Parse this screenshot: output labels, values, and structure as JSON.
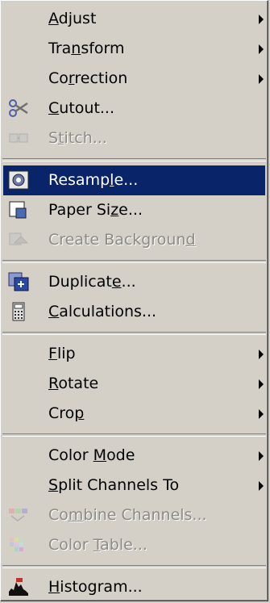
{
  "menu": {
    "groups": [
      [
        {
          "name": "adjust",
          "label": "Adjust",
          "submenu": true
        },
        {
          "name": "transform",
          "label": "Transform",
          "submenu": true
        },
        {
          "name": "correction",
          "label": "Correction",
          "submenu": true
        },
        {
          "name": "cutout",
          "label": "Cutout...",
          "icon": "scissors-icon"
        },
        {
          "name": "stitch",
          "label": "Stitch...",
          "icon": "stitch-icon",
          "disabled": true
        }
      ],
      [
        {
          "name": "resample",
          "label": "Resample...",
          "icon": "resample-icon",
          "selected": true
        },
        {
          "name": "paper-size",
          "label": "Paper Size...",
          "icon": "paper-size-icon"
        },
        {
          "name": "create-background",
          "label": "Create Background",
          "icon": "create-background-icon",
          "disabled": true
        }
      ],
      [
        {
          "name": "duplicate",
          "label": "Duplicate...",
          "icon": "duplicate-icon"
        },
        {
          "name": "calculations",
          "label": "Calculations...",
          "icon": "calculator-icon"
        }
      ],
      [
        {
          "name": "flip",
          "label": "Flip",
          "submenu": true
        },
        {
          "name": "rotate",
          "label": "Rotate",
          "submenu": true
        },
        {
          "name": "crop",
          "label": "Crop",
          "submenu": true
        }
      ],
      [
        {
          "name": "color-mode",
          "label": "Color Mode",
          "submenu": true
        },
        {
          "name": "split-channels-to",
          "label": "Split Channels To",
          "submenu": true
        },
        {
          "name": "combine-channels",
          "label": "Combine Channels...",
          "icon": "combine-channels-icon",
          "disabled": true
        },
        {
          "name": "color-table",
          "label": "Color Table...",
          "icon": "color-table-icon",
          "disabled": true
        }
      ],
      [
        {
          "name": "histogram",
          "label": "Histogram...",
          "icon": "histogram-icon"
        }
      ]
    ],
    "colors": {
      "highlight": "#0a246a",
      "face": "#d4d0c8",
      "disabled_text": "#8d8a85"
    }
  }
}
